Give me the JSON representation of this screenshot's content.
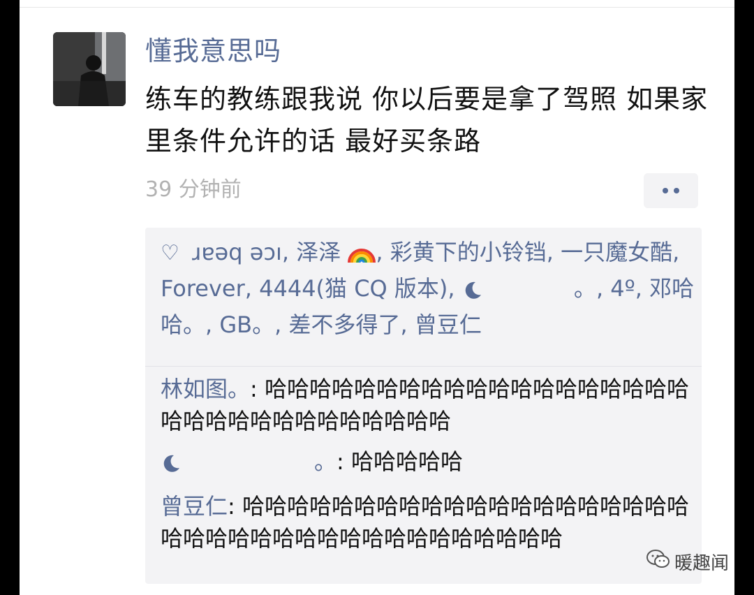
{
  "post": {
    "username": "懂我意思吗",
    "text": "练车的教练跟我说 你以后要是拿了驾照 如果家里条件允许的话 最好买条路",
    "time": "39 分钟前"
  },
  "likes": {
    "names": [
      "ɹɐǝq ǝɔı",
      "泽泽",
      "彩黄下的小铃铛",
      "一只魔女酷",
      "Forever",
      "4444(猫 CQ 版本)",
      "。",
      "4º",
      "邓哈哈。",
      "GB。",
      "差不多得了",
      "曾豆仁"
    ],
    "icons": {
      "like": "heart-outline-icon",
      "rainbow": "rainbow-icon",
      "moon": "crescent-moon-icon"
    }
  },
  "comments": [
    {
      "name": "林如图。",
      "text": "哈哈哈哈哈哈哈哈哈哈哈哈哈哈哈哈哈哈哈哈哈哈哈哈哈哈哈哈哈哈哈哈"
    },
    {
      "name": "。",
      "text": "哈哈哈哈哈"
    },
    {
      "name": "曾豆仁",
      "text": "哈哈哈哈哈哈哈哈哈哈哈哈哈哈哈哈哈哈哈哈哈哈哈哈哈哈哈哈哈哈哈哈哈哈哈哈哈哈"
    }
  ],
  "watermark": {
    "text": "暖趣闻",
    "icon": "wechat-icon"
  },
  "colors": {
    "link": "#576b95",
    "timestamp": "#b2b2b2",
    "comment_bg": "#f3f3f5"
  }
}
